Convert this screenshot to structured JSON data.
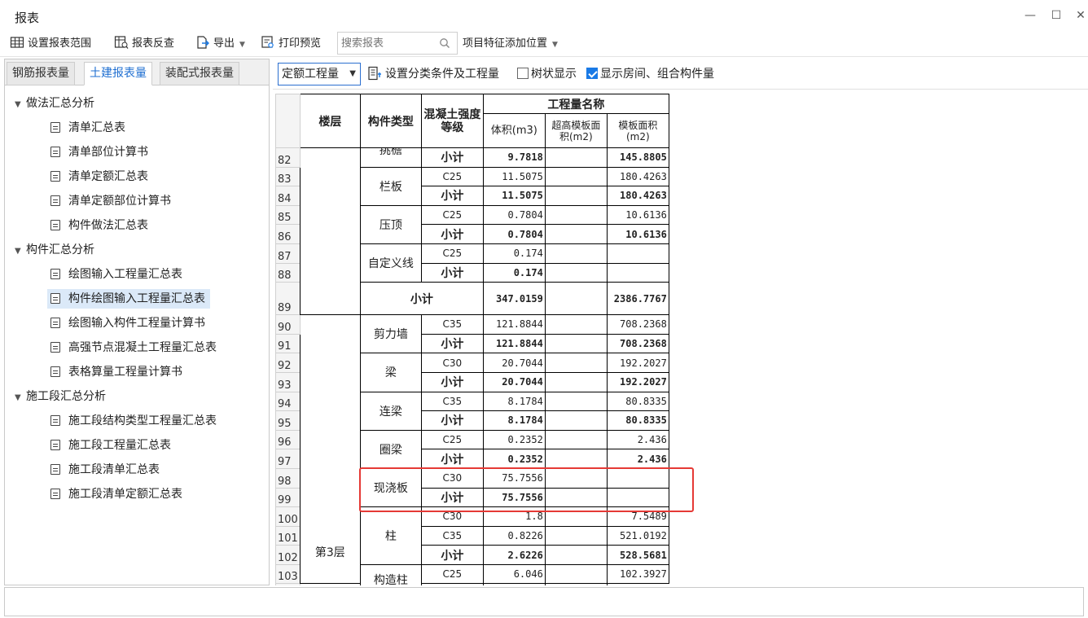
{
  "window": {
    "title": "报表",
    "minimize": "—",
    "maximize": "☐",
    "close": "✕"
  },
  "toolbar": {
    "set_range": "设置报表范围",
    "reverse_check": "报表反查",
    "export": "导出",
    "print_preview": "打印预览",
    "search_placeholder": "搜索报表",
    "feature_position": "项目特征添加位置"
  },
  "left_tabs": [
    "钢筋报表量",
    "土建报表量",
    "装配式报表量"
  ],
  "tree": {
    "group1": "做法汇总分析",
    "g1_items": [
      "清单汇总表",
      "清单部位计算书",
      "清单定额汇总表",
      "清单定额部位计算书",
      "构件做法汇总表"
    ],
    "group2": "构件汇总分析",
    "g2_items": [
      "绘图输入工程量汇总表",
      "构件绘图输入工程量汇总表",
      "绘图输入构件工程量计算书",
      "高强节点混凝土工程量汇总表",
      "表格算量工程量计算书"
    ],
    "group3": "施工段汇总分析",
    "g3_items": [
      "施工段结构类型工程量汇总表",
      "施工段工程量汇总表",
      "施工段清单汇总表",
      "施工段清单定额汇总表"
    ]
  },
  "right_toolbar": {
    "dropdown": "定额工程量",
    "set_condition": "设置分类条件及工程量",
    "tree_display": "树状显示",
    "tree_display_checked": false,
    "show_rooms": "显示房间、组合构件量",
    "show_rooms_checked": true
  },
  "grid": {
    "headers": {
      "floor": "楼层",
      "type": "构件类型",
      "grade": "混凝土强度等级",
      "group": "工程量名称",
      "volume": "体积(m3)",
      "over_form": "超高模板面积(m2)",
      "form_area": "模板面积(m2)"
    },
    "floor_label": "第3层",
    "partial_top_type": "挑檐",
    "row_numbers": [
      "82",
      "83",
      "84",
      "85",
      "86",
      "87",
      "88",
      "89",
      "90",
      "91",
      "92",
      "93",
      "94",
      "95",
      "96",
      "97",
      "98",
      "99",
      "100",
      "101",
      "102",
      "103"
    ],
    "types": {
      "r83": "栏板",
      "r85": "压顶",
      "r87": "自定义线",
      "r89": "小计",
      "r90": "剪力墙",
      "r92": "梁",
      "r94": "连梁",
      "r96": "圈梁",
      "r98": "现浇板",
      "r100": "柱",
      "r103": "构造柱"
    },
    "subtotal": "小计",
    "rows": {
      "r82": {
        "volume": "9.7818",
        "form": "145.8805"
      },
      "r83": {
        "grade": "C25",
        "volume": "11.5075",
        "form": "180.4263"
      },
      "r84": {
        "volume": "11.5075",
        "form": "180.4263"
      },
      "r85": {
        "grade": "C25",
        "volume": "0.7804",
        "form": "10.6136"
      },
      "r86": {
        "volume": "0.7804",
        "form": "10.6136"
      },
      "r87": {
        "grade": "C25",
        "volume": "0.174",
        "form": ""
      },
      "r88": {
        "volume": "0.174",
        "form": ""
      },
      "r89": {
        "volume": "347.0159",
        "form": "2386.7767"
      },
      "r90": {
        "grade": "C35",
        "volume": "121.8844",
        "form": "708.2368"
      },
      "r91": {
        "volume": "121.8844",
        "form": "708.2368"
      },
      "r92": {
        "grade": "C30",
        "volume": "20.7044",
        "form": "192.2027"
      },
      "r93": {
        "volume": "20.7044",
        "form": "192.2027"
      },
      "r94": {
        "grade": "C35",
        "volume": "8.1784",
        "form": "80.8335"
      },
      "r95": {
        "volume": "8.1784",
        "form": "80.8335"
      },
      "r96": {
        "grade": "C25",
        "volume": "0.2352",
        "form": "2.436"
      },
      "r97": {
        "volume": "0.2352",
        "form": "2.436"
      },
      "r98": {
        "grade": "C30",
        "volume": "75.7556",
        "form": ""
      },
      "r99": {
        "volume": "75.7556",
        "form": ""
      },
      "r100": {
        "grade": "C30",
        "volume": "1.8",
        "form": "7.5489"
      },
      "r101": {
        "grade": "C35",
        "volume": "0.8226",
        "form": "521.0192"
      },
      "r102": {
        "volume": "2.6226",
        "form": "528.5681"
      },
      "r103": {
        "grade": "C25",
        "volume": "6.046",
        "form": "102.3927"
      }
    }
  }
}
